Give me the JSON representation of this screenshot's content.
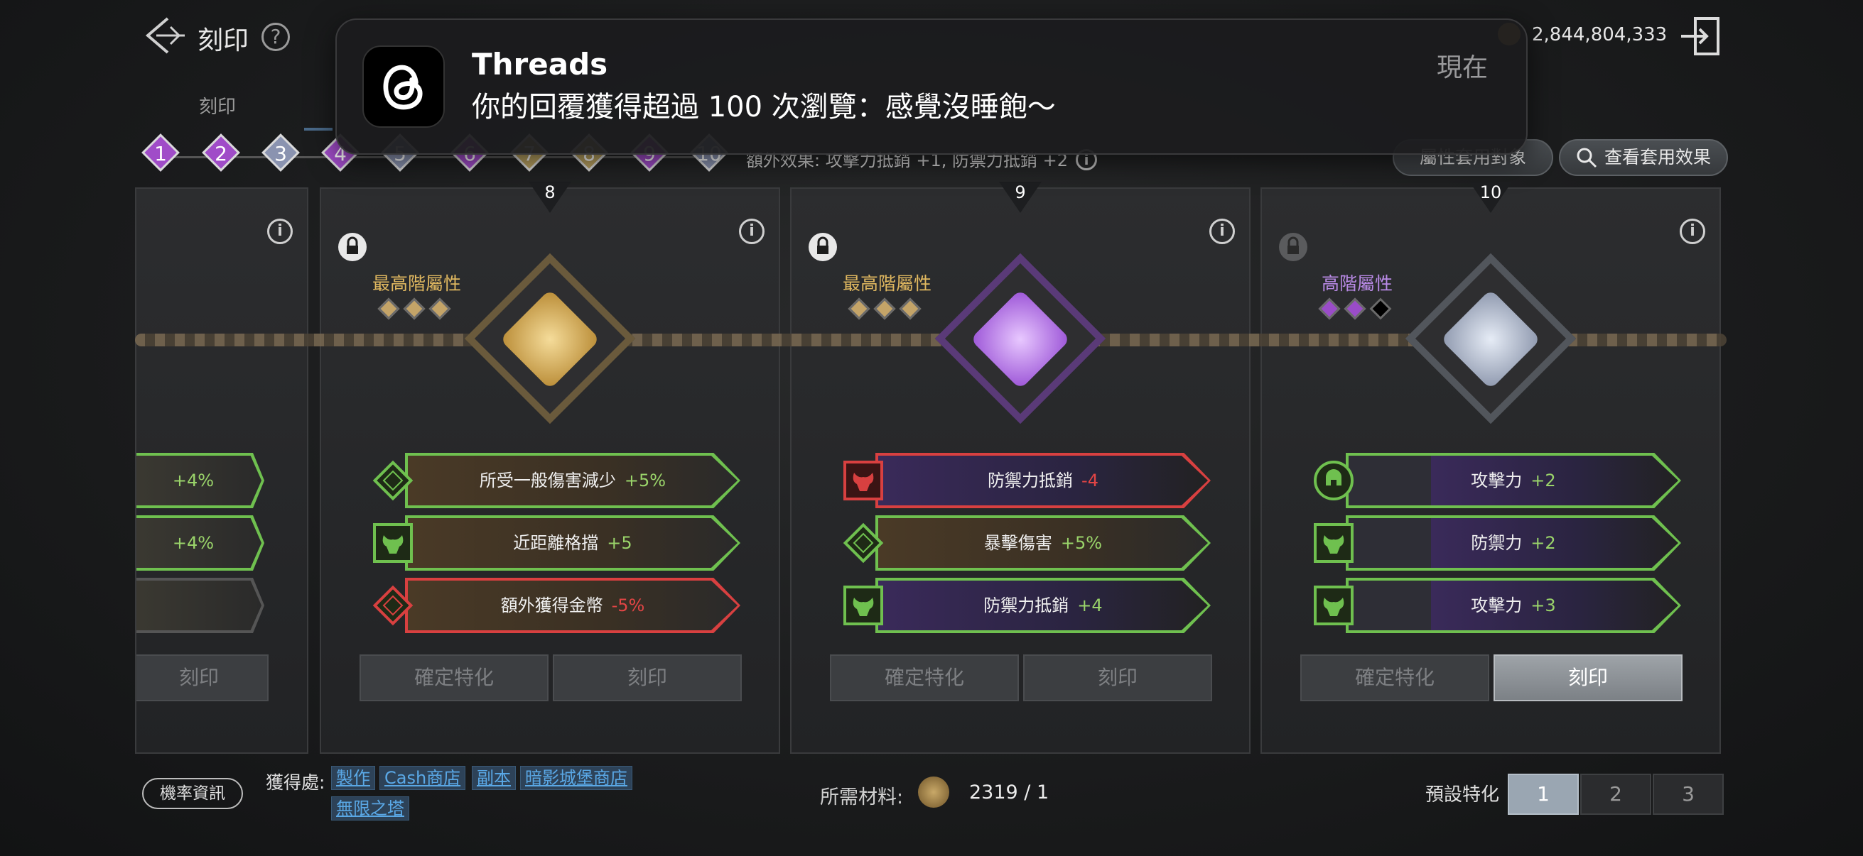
{
  "header": {
    "title": "刻印",
    "help_glyph": "?",
    "currency_value": "2,844,804,333",
    "tab_engrave": "刻印"
  },
  "stages": [
    "1",
    "2",
    "3",
    "4",
    "5",
    "6",
    "7",
    "8",
    "9",
    "10"
  ],
  "extra_effect": "額外效果: 攻擊力抵銷 +1, 防禦力抵銷 +2",
  "buttons": {
    "attribute_target": "屬性套用對象",
    "view_effect": "查看套用效果",
    "confirm": "確定特化",
    "engrave": "刻印"
  },
  "partial_card": {
    "stats": [
      "+4%",
      "+4%",
      ""
    ]
  },
  "cards": [
    {
      "number": "8",
      "tier_label": "最高階屬性",
      "tier_color": "#e0b860",
      "stats": [
        {
          "name": "所受一般傷害減少",
          "value": "+5%",
          "tone": "green"
        },
        {
          "name": "近距離格擋",
          "value": "+5",
          "tone": "green"
        },
        {
          "name": "額外獲得金幣",
          "value": "-5%",
          "tone": "red"
        }
      ]
    },
    {
      "number": "9",
      "tier_label": "最高階屬性",
      "tier_color": "#e0b860",
      "stats": [
        {
          "name": "防禦力抵銷",
          "value": "-4",
          "tone": "red"
        },
        {
          "name": "暴擊傷害",
          "value": "+5%",
          "tone": "green"
        },
        {
          "name": "防禦力抵銷",
          "value": "+4",
          "tone": "green"
        }
      ]
    },
    {
      "number": "10",
      "tier_label": "高階屬性",
      "tier_color": "#b98ae6",
      "stats": [
        {
          "name": "攻擊力",
          "value": "+2",
          "tone": "green"
        },
        {
          "name": "防禦力",
          "value": "+2",
          "tone": "green"
        },
        {
          "name": "攻擊力",
          "value": "+3",
          "tone": "green"
        }
      ]
    }
  ],
  "footer": {
    "rate_info": "機率資訊",
    "obtain_label": "獲得處:",
    "obtain_links": [
      "製作",
      "Cash商店",
      "副本",
      "暗影城堡商店",
      "無限之塔"
    ],
    "material_label": "所需材料:",
    "material_value": "2319 / 1",
    "preset_label": "預設特化",
    "presets": [
      "1",
      "2",
      "3"
    ],
    "active_preset": "1"
  },
  "notification": {
    "app": "Threads",
    "body": "你的回覆獲得超過 100 次瀏覽：感覺沒睡飽～",
    "time": "現在"
  },
  "colors": {
    "green": "#6fc04f",
    "red": "#d84040",
    "gold": "#e0b860",
    "purple": "#b98ae6",
    "stage_purple": "#a04cc8",
    "stage_grey": "#8a93b0",
    "stage_gold": "#b8a060"
  }
}
